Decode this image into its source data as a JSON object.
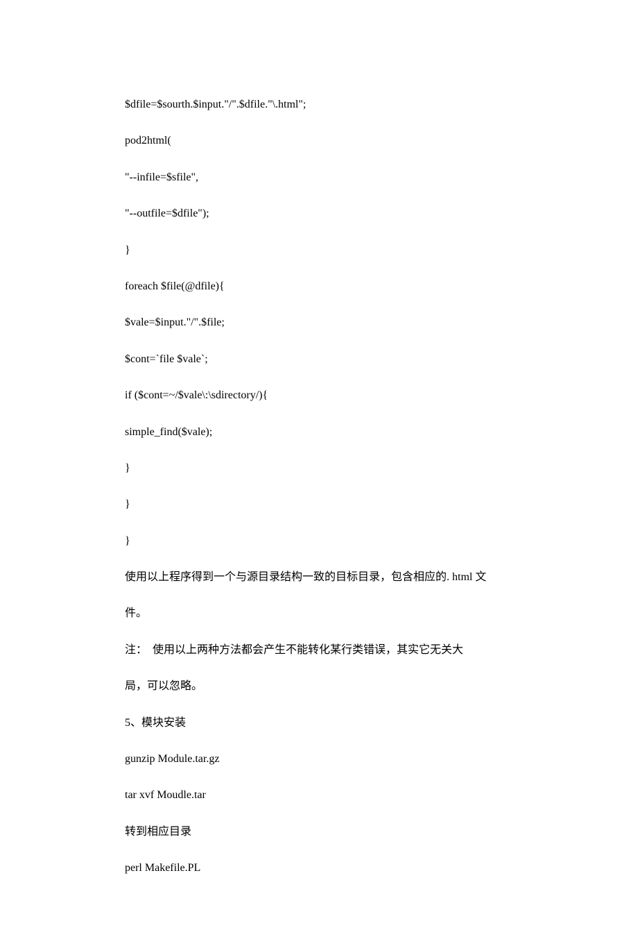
{
  "lines": [
    "$dfile=$sourth.$input.\"/\".$dfile.\"\\.html\";",
    "pod2html(",
    "\"--infile=$sfile\",",
    "\"--outfile=$dfile\");",
    "}",
    "foreach $file(@dfile){",
    "$vale=$input.\"/\".$file;",
    "$cont=`file $vale`;",
    "if ($cont=~/$vale\\:\\sdirectory/){",
    "simple_find($vale);",
    "}",
    "}",
    "}",
    "使用以上程序得到一个与源目录结构一致的目标目录，包含相应的. html 文",
    "件。",
    "注：　使用以上两种方法都会产生不能转化某行类错误，其实它无关大",
    "局，可以忽略。",
    "5、模块安装",
    "gunzip Module.tar.gz",
    "tar xvf Moudle.tar",
    "转到相应目录",
    "perl Makefile.PL"
  ]
}
